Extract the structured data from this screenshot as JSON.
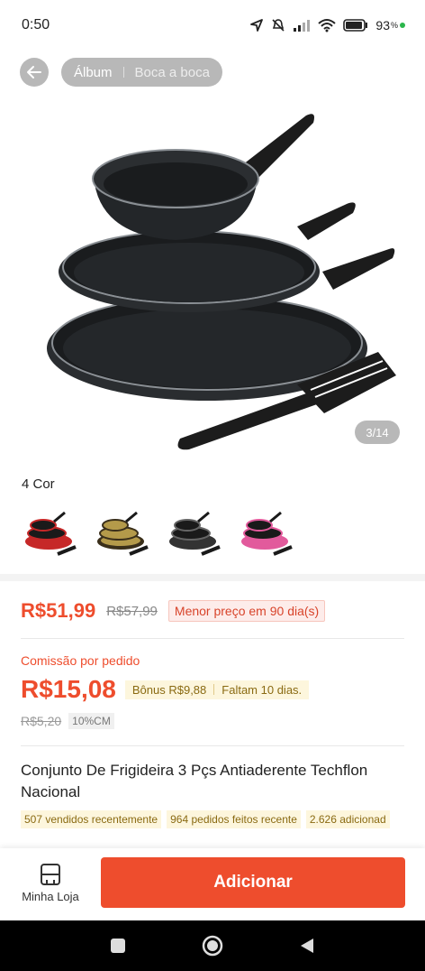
{
  "status_bar": {
    "time": "0:50",
    "battery": "93",
    "battery_unit": "%"
  },
  "gallery": {
    "tabs": [
      "Álbum",
      "Boca a boca"
    ],
    "counter": "3/14"
  },
  "colors": {
    "title": "4 Cor",
    "swatches": [
      {
        "icon": "red-pan-set",
        "accent": "#c62828"
      },
      {
        "icon": "gold-pan-set",
        "accent": "#b49a4a"
      },
      {
        "icon": "black-pan-set",
        "accent": "#333333"
      },
      {
        "icon": "pink-pan-set",
        "accent": "#e25a9c"
      }
    ]
  },
  "price": {
    "current": "R$51,99",
    "original": "R$57,99",
    "badge": "Menor preço em 90 dia(s)"
  },
  "commission": {
    "label": "Comissão por pedido",
    "value": "R$15,08",
    "bonus": "Bônus R$9,88",
    "remaining": "Faltam 10 dias.",
    "old_value": "R$5,20",
    "rate": "10%CM"
  },
  "product": {
    "title": "Conjunto De Frigideira 3 Pçs Antiaderente Techflon Nacional",
    "tags": [
      "507 vendidos recentemente",
      "964 pedidos feitos recente",
      "2.626 adicionad"
    ]
  },
  "action_bar": {
    "my_store": "Minha Loja",
    "add": "Adicionar"
  },
  "theme": {
    "accent": "#ee4d2d"
  }
}
